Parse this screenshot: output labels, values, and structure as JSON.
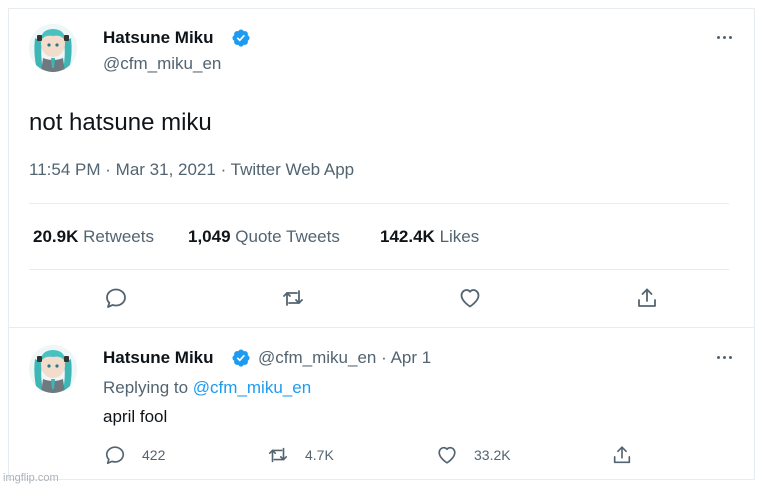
{
  "colors": {
    "accent": "#1d9bf0",
    "text": "#0f1419",
    "muted": "#536471",
    "border": "#e6ecf0"
  },
  "main_tweet": {
    "author_name": "Hatsune Miku",
    "author_handle": "@cfm_miku_en",
    "avatar_icon": "miku-avatar",
    "text": "not hatsune miku",
    "time": "11:54 PM",
    "sep": "·",
    "date": "Mar 31, 2021",
    "source": "Twitter Web App",
    "stats": {
      "retweets_count": "20.9K",
      "retweets_label": "Retweets",
      "quotes_count": "1,049",
      "quotes_label": "Quote Tweets",
      "likes_count": "142.4K",
      "likes_label": "Likes"
    },
    "actions": [
      "reply-icon",
      "retweet-icon",
      "like-icon",
      "share-icon"
    ]
  },
  "reply_tweet": {
    "author_name": "Hatsune Miku",
    "author_handle": "@cfm_miku_en",
    "sep": "·",
    "date": "Apr 1",
    "replying_prefix": "Replying to",
    "replying_handle": "@cfm_miku_en",
    "text": "april fool",
    "reply_count": "422",
    "retweet_count": "4.7K",
    "like_count": "33.2K"
  },
  "watermark": "imgflip.com"
}
